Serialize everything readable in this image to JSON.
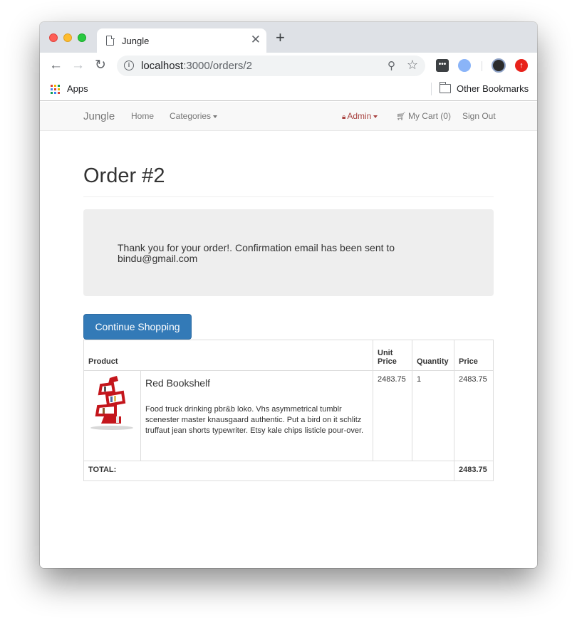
{
  "browser": {
    "tab_title": "Jungle",
    "url_host": "localhost",
    "url_path": ":3000/orders/2",
    "bookmarks": {
      "apps": "Apps",
      "other": "Other Bookmarks"
    },
    "colors": {
      "apps_icon": [
        "#db4437",
        "#f4b400",
        "#0f9d58",
        "#4285f4",
        "#db4437",
        "#f4b400",
        "#0f9d58",
        "#4285f4",
        "#db4437"
      ]
    }
  },
  "navbar": {
    "brand": "Jungle",
    "home": "Home",
    "categories": "Categories",
    "admin": "Admin",
    "cart": "My Cart (0)",
    "signout": "Sign Out"
  },
  "order": {
    "title": "Order #2",
    "message": "Thank you for your order!. Confirmation email has been sent to bindu@gmail.com",
    "continue_button": "Continue Shopping",
    "headers": {
      "product": "Product",
      "unit_price": "Unit Price",
      "quantity": "Quantity",
      "price": "Price"
    },
    "items": [
      {
        "name": "Red Bookshelf",
        "description": "Food truck drinking pbr&b loko. Vhs asymmetrical tumblr scenester master knausgaard authentic. Put a bird on it schlitz truffaut jean shorts typewriter. Etsy kale chips listicle pour-over.",
        "unit_price": "2483.75",
        "quantity": "1",
        "price": "2483.75"
      }
    ],
    "total_label": "TOTAL:",
    "total_value": "2483.75"
  }
}
